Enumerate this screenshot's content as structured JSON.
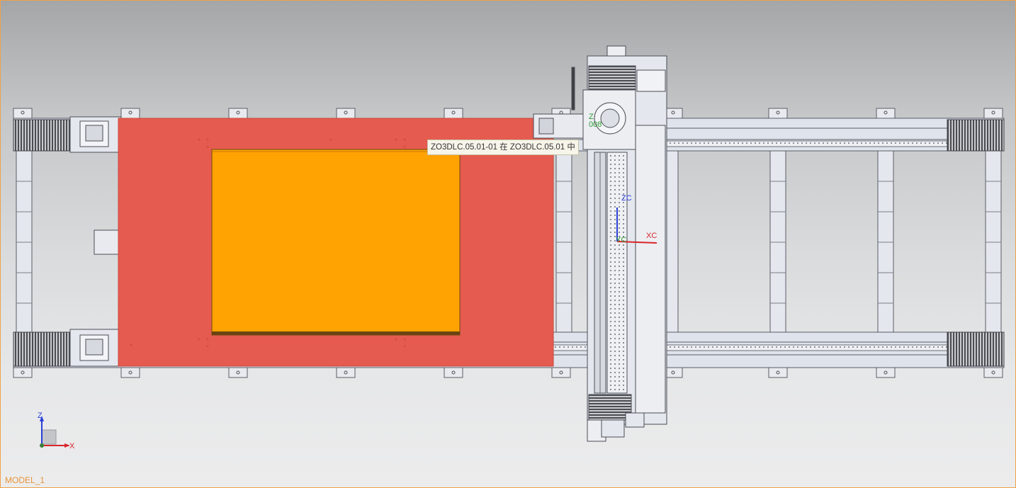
{
  "tooltip": {
    "text": "ZO3DLC.05.01-01 在 ZO3DLC.05.01 中"
  },
  "wcs": {
    "zc_label": "ZC",
    "yc_label": "YC",
    "xc_label": "XC"
  },
  "part_label": {
    "line1": "Z",
    "line2": "008"
  },
  "view_triad": {
    "z_label": "Z",
    "x_label": "X"
  },
  "model_name": "MODEL_1",
  "colors": {
    "selected_plate": "#e55b4f",
    "workpiece": "#ffa302",
    "frame": "#dfe3ec",
    "frame_outline": "#5b5e66",
    "viewport_border": "#f0a24a"
  }
}
